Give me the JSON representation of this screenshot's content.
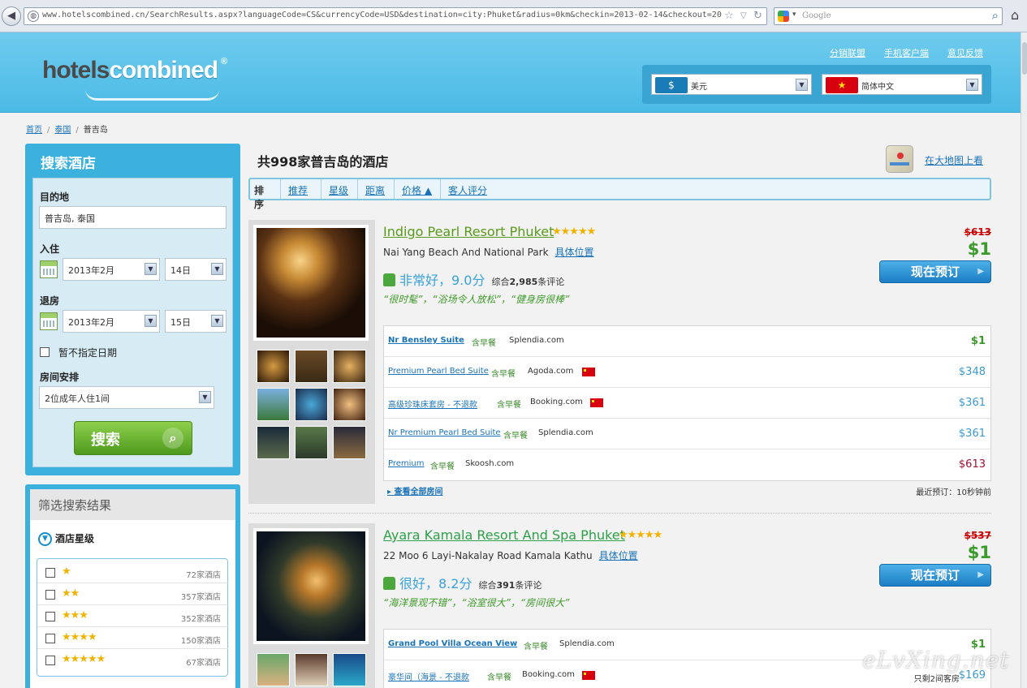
{
  "browser": {
    "url": "www.hotelscombined.cn/SearchResults.aspx?languageCode=CS&currencyCode=USD&destination=city:Phuket&radius=0km&checkin=2013-02-14&checkout=20",
    "search_placeholder": "Google"
  },
  "header": {
    "logo_part1": "hotels",
    "logo_part2": "combined",
    "logo_reg": "®",
    "links": [
      "分销联盟",
      "手机客户端",
      "意见反馈"
    ],
    "currency_badge": "$",
    "currency": "美元",
    "language_badge": "★",
    "language": "简体中文"
  },
  "breadcrumb": [
    "首页",
    "泰国",
    "普吉岛"
  ],
  "search": {
    "title": "搜索酒店",
    "dest_label": "目的地",
    "dest_value": "普吉岛, 泰国",
    "checkin_label": "入住",
    "checkin_month": "2013年2月",
    "checkin_day": "14日",
    "checkout_label": "退房",
    "checkout_month": "2013年2月",
    "checkout_day": "15日",
    "nodate_label": "暂不指定日期",
    "room_label": "房间安排",
    "room_value": "2位成年人住1间",
    "button": "搜索"
  },
  "filter": {
    "title": "筛选搜索结果",
    "star_header": "酒店星级",
    "rows": [
      {
        "stars": "★",
        "count": "72家酒店"
      },
      {
        "stars": "★★",
        "count": "357家酒店"
      },
      {
        "stars": "★★★",
        "count": "352家酒店"
      },
      {
        "stars": "★★★★",
        "count": "150家酒店"
      },
      {
        "stars": "★★★★★",
        "count": "67家酒店"
      }
    ]
  },
  "results": {
    "heading": "共998家普吉岛的酒店",
    "map_link": "在大地图上看",
    "sort": [
      "排序",
      "推荐",
      "星级",
      "距离",
      "价格 ▲",
      "客人评分"
    ]
  },
  "hotels": [
    {
      "name": "Indigo Pearl Resort Phuket",
      "stars": "★★★★★",
      "address": "Nai Yang Beach And National Park",
      "location_link": "具体位置",
      "rating": "非常好，9.0分",
      "reviews_prefix": "综合",
      "reviews_count": "2,985",
      "reviews_suffix": "条评论",
      "quotes": "“很时髦”，“浴场令人放松”，“健身房很棒”",
      "old_price": "$613",
      "price": "$1",
      "book": "现在预订",
      "rooms": [
        {
          "name": "Nr Bensley Suite",
          "breakfast": "含早餐",
          "provider": "Splendia.com",
          "price": "$1"
        },
        {
          "name": "Premium Pearl Bed Suite",
          "breakfast": "含早餐",
          "provider": "Agoda.com",
          "price": "$348"
        },
        {
          "name": "高级珍珠床套房 - 不退款",
          "breakfast": "含早餐",
          "provider": "Booking.com",
          "price": "$361"
        },
        {
          "name": "Nr Premium Pearl Bed Suite",
          "breakfast": "含早餐",
          "provider": "Splendia.com",
          "price": "$361"
        },
        {
          "name": "Premium",
          "breakfast": "含早餐",
          "provider": "Skoosh.com",
          "price": "$613"
        }
      ],
      "all_rooms": "查看全部房间",
      "last_booked": "最近预订：10秒钟前"
    },
    {
      "name": "Ayara Kamala Resort And Spa Phuket",
      "stars": "★★★★★",
      "address": "22 Moo 6 Layi-Nakalay Road Kamala Kathu",
      "location_link": "具体位置",
      "rating": "很好，8.2分",
      "reviews_prefix": "综合",
      "reviews_count": "391",
      "reviews_suffix": "条评论",
      "quotes": "“海洋景观不错”，“浴室很大”，“房间很大”",
      "old_price": "$537",
      "price": "$1",
      "book": "现在预订",
      "rooms": [
        {
          "name": "Grand Pool Villa Ocean View",
          "breakfast": "含早餐",
          "provider": "Splendia.com",
          "price": "$1"
        },
        {
          "name": "豪华间（海景 - 不退款",
          "breakfast": "含早餐",
          "provider": "Booking.com",
          "price": "$169",
          "note": "只剩2间客房"
        }
      ]
    }
  ],
  "watermark": "eLvXing.net",
  "colors": {
    "header": "#4bbbe6",
    "green": "#3a9a2a",
    "link": "#1a73b8",
    "star": "#f2b300"
  }
}
